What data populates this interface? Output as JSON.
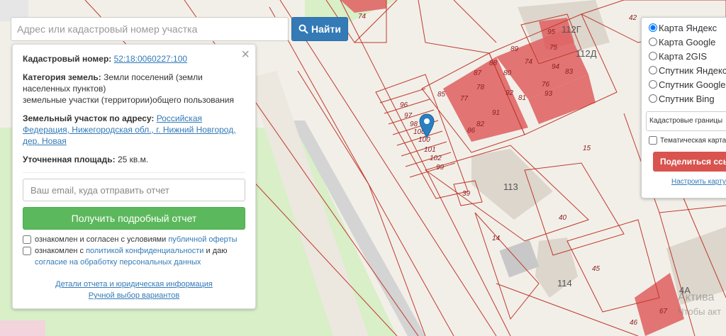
{
  "search": {
    "placeholder": "Адрес или кадастровый номер участка",
    "button_label": "Найти"
  },
  "info": {
    "cad_label": "Кадастровый номер:",
    "cad_value": "52:18:0060227:100",
    "category_label": "Категория земель:",
    "category_value_1": "Земли поселений (земли",
    "category_value_2": "населенных пунктов)",
    "category_value_3": "земельные участки (территории)общего пользования",
    "address_label": "Земельный участок по адресу:",
    "address_value": "Российская Федерация, Нижегородская обл., г. Нижний Новгород, дер. Новая",
    "area_label": "Уточненная площадь:",
    "area_value": "25 кв.м.",
    "email_placeholder": "Ваш email, куда отправить отчет",
    "report_button": "Получить подробный отчет",
    "check1_text": "ознакомлен и согласен с условиями",
    "check1_link": "публичной оферты",
    "check2_text": "ознакомлен с",
    "check2_link": "политикой конфиденциальности",
    "check2_tail": "и даю",
    "check2_link2": "согласие на обработку персональных данных",
    "details_link": "Детали отчета и юридическая информация",
    "manual_link": "Ручной выбор вариантов"
  },
  "layers": {
    "options": [
      "Карта Яндекс",
      "Карта Google",
      "Карта 2GIS",
      "Спутник Яндекс",
      "Спутник Google",
      "Спутник Bing"
    ],
    "selected_index": 0,
    "select_value": "Кадастровые границы",
    "thematic_label": "Тематическая карта",
    "share_button": "Поделиться ссылкой",
    "configure_link": "Настроить карту"
  },
  "map_labels": {
    "parcels": [
      "74",
      "42",
      "112Г",
      "112Д",
      "95",
      "75",
      "89",
      "88",
      "74",
      "94",
      "83",
      "87",
      "80",
      "76",
      "93",
      "78",
      "92",
      "81",
      "85",
      "77",
      "91",
      "82",
      "86",
      "96",
      "97",
      "98",
      "100",
      "100",
      "101",
      "102",
      "99",
      "15",
      "39",
      "113",
      "40",
      "14",
      "45",
      "114",
      "4А",
      "67",
      "46"
    ]
  },
  "watermark": {
    "line1": "Актива",
    "line2": "Чтобы акт"
  },
  "colors": {
    "parcel_fill": "#e06666",
    "boundary": "#c0392b",
    "green_area": "#d6efc6",
    "building": "#dcd6cc"
  }
}
